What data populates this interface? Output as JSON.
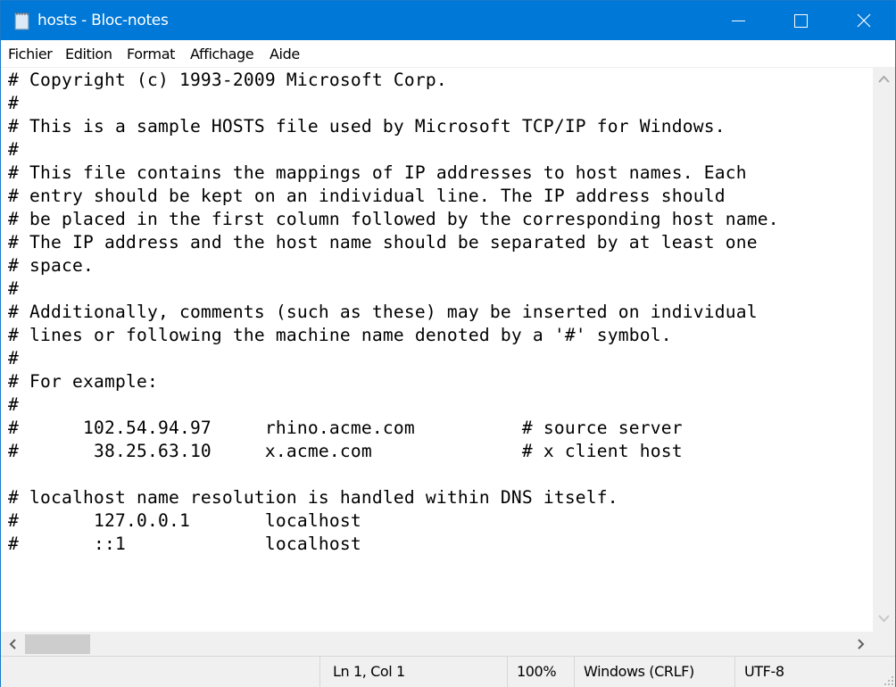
{
  "window": {
    "title": "hosts - Bloc-notes",
    "accent_color": "#0078d7",
    "controls": [
      "minimize-icon",
      "maximize-icon",
      "close-icon"
    ]
  },
  "menu": {
    "items": [
      {
        "label": "Fichier"
      },
      {
        "label": "Edition"
      },
      {
        "label": "Format"
      },
      {
        "label": "Affichage"
      },
      {
        "label": "Aide"
      }
    ]
  },
  "editor": {
    "content": "# Copyright (c) 1993-2009 Microsoft Corp.\n#\n# This is a sample HOSTS file used by Microsoft TCP/IP for Windows.\n#\n# This file contains the mappings of IP addresses to host names. Each\n# entry should be kept on an individual line. The IP address should\n# be placed in the first column followed by the corresponding host name.\n# The IP address and the host name should be separated by at least one\n# space.\n#\n# Additionally, comments (such as these) may be inserted on individual\n# lines or following the machine name denoted by a '#' symbol.\n#\n# For example:\n#\n#      102.54.94.97     rhino.acme.com          # source server\n#       38.25.63.10     x.acme.com              # x client host\n\n# localhost name resolution is handled within DNS itself.\n#\t127.0.0.1       localhost\n#\t::1             localhost"
  },
  "statusbar": {
    "position": "Ln 1, Col 1",
    "zoom": "100%",
    "line_ending": "Windows (CRLF)",
    "encoding": "UTF-8"
  }
}
